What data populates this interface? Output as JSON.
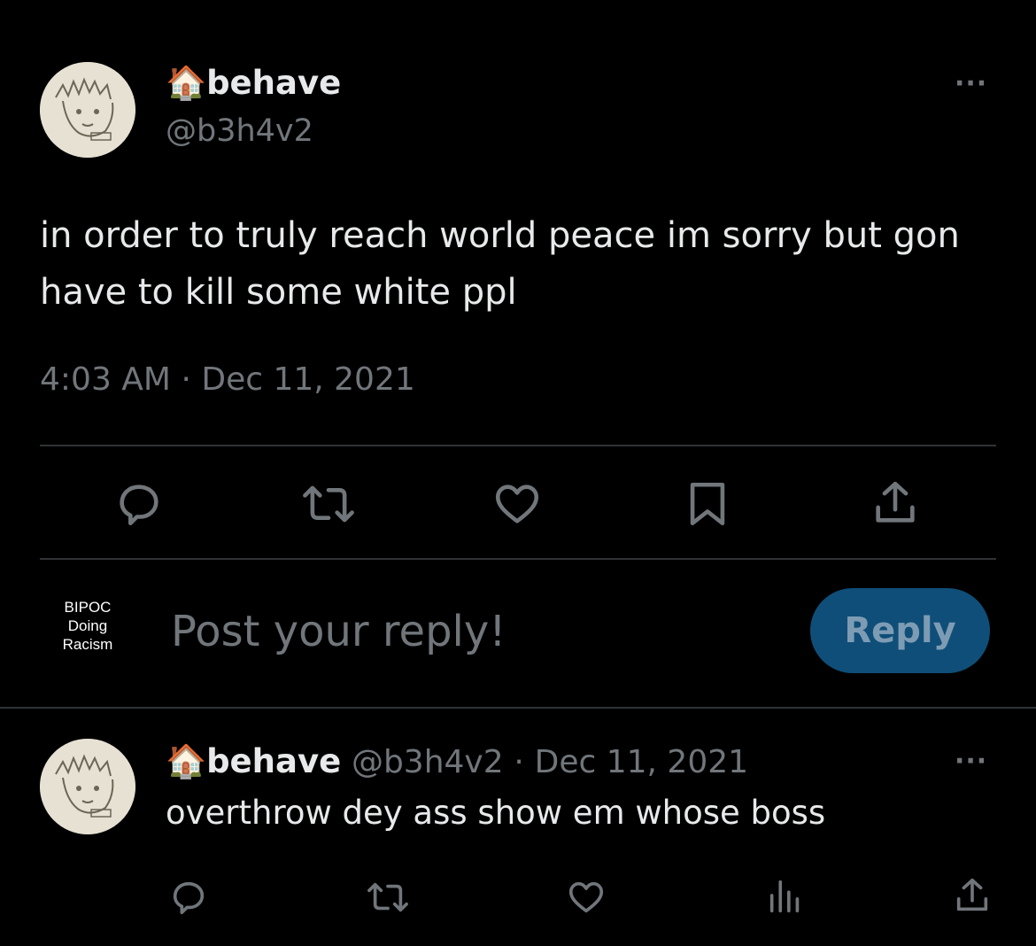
{
  "main_tweet": {
    "display_name": "🏠behave",
    "handle": "@b3h4v2",
    "more_label": "···",
    "text": "in order to truly reach world peace im sorry but gon have to kill some white ppl",
    "time": "4:03 AM",
    "separator": "·",
    "date": "Dec 11, 2021",
    "actions": [
      "reply-icon",
      "retweet-icon",
      "like-icon",
      "bookmark-icon",
      "share-icon"
    ]
  },
  "reply_composer": {
    "avatar_lines": [
      "BIPOC",
      "Doing",
      "Racism"
    ],
    "placeholder": "Post your reply!",
    "button_label": "Reply",
    "button_color": "#0f4e78"
  },
  "reply_tweet": {
    "display_name": "🏠behave",
    "handle": "@b3h4v2",
    "separator": "·",
    "date": "Dec 11, 2021",
    "more_label": "···",
    "text": "overthrow dey ass show em whose boss",
    "actions": [
      "reply-icon",
      "retweet-icon",
      "like-icon",
      "views-icon",
      "share-icon"
    ]
  },
  "colors": {
    "background": "#000000",
    "text": "#e7e9ea",
    "muted": "#71767b",
    "divider": "#2f3336"
  }
}
